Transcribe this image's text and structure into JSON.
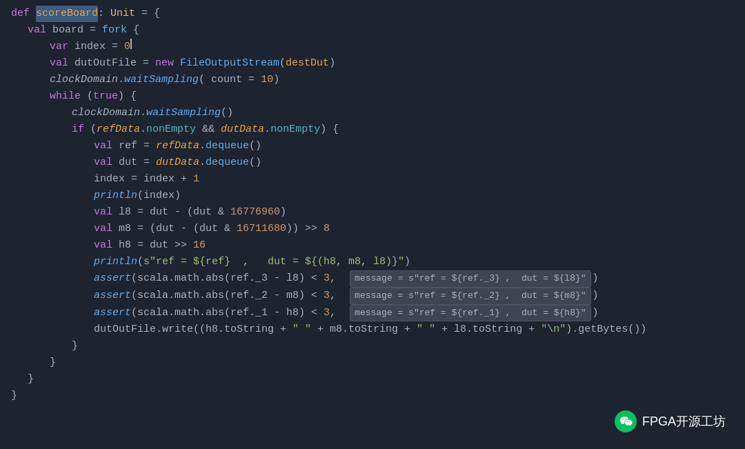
{
  "editor": {
    "background": "#1e2330",
    "lines": [
      {
        "indent": 0,
        "content": "def_scoreBoard_colon_Unit_eq_open"
      },
      {
        "indent": 1,
        "content": "val_board_eq_fork_open"
      },
      {
        "indent": 2,
        "content": "var_index_eq_0"
      },
      {
        "indent": 2,
        "content": "val_dutOutFile_eq_new_FileOutputStream_destDut"
      },
      {
        "indent": 2,
        "content": "clockDomain_waitSampling_count10"
      },
      {
        "indent": 2,
        "content": "while_true_open"
      },
      {
        "indent": 3,
        "content": "clockDomain_waitSampling"
      },
      {
        "indent": 3,
        "content": "if_refData_nonEmpty_dutData_nonEmpty_open"
      },
      {
        "indent": 4,
        "content": "val_ref_eq_refData_dequeue"
      },
      {
        "indent": 4,
        "content": "val_dut_eq_dutData_dequeue"
      },
      {
        "indent": 4,
        "content": "index_eq_index_plus_1"
      },
      {
        "indent": 4,
        "content": "println_index"
      },
      {
        "indent": 4,
        "content": "val_l8_eq_dut_minus_dut_and_16776960"
      },
      {
        "indent": 4,
        "content": "val_m8_eq_dut_minus_dut_and_16711680_shr8"
      },
      {
        "indent": 4,
        "content": "val_h8_eq_dut_shr_16"
      },
      {
        "indent": 4,
        "content": "println_s_ref_dut_h8_m8_l8"
      },
      {
        "indent": 4,
        "content": "assert_ref3_l8_message_ref3_l8"
      },
      {
        "indent": 4,
        "content": "assert_ref2_m8_message_ref2_m8"
      },
      {
        "indent": 4,
        "content": "assert_ref1_h8_message_ref1_h8"
      },
      {
        "indent": 4,
        "content": "dutOutFile_write_h8_m8_l8_newline"
      },
      {
        "indent": 3,
        "content": "close_brace"
      },
      {
        "indent": 2,
        "content": "close_brace2"
      },
      {
        "indent": 1,
        "content": "close_brace3"
      },
      {
        "indent": 0,
        "content": "close_brace4"
      }
    ]
  },
  "watermark": {
    "org": "FPGA开源工坊"
  }
}
